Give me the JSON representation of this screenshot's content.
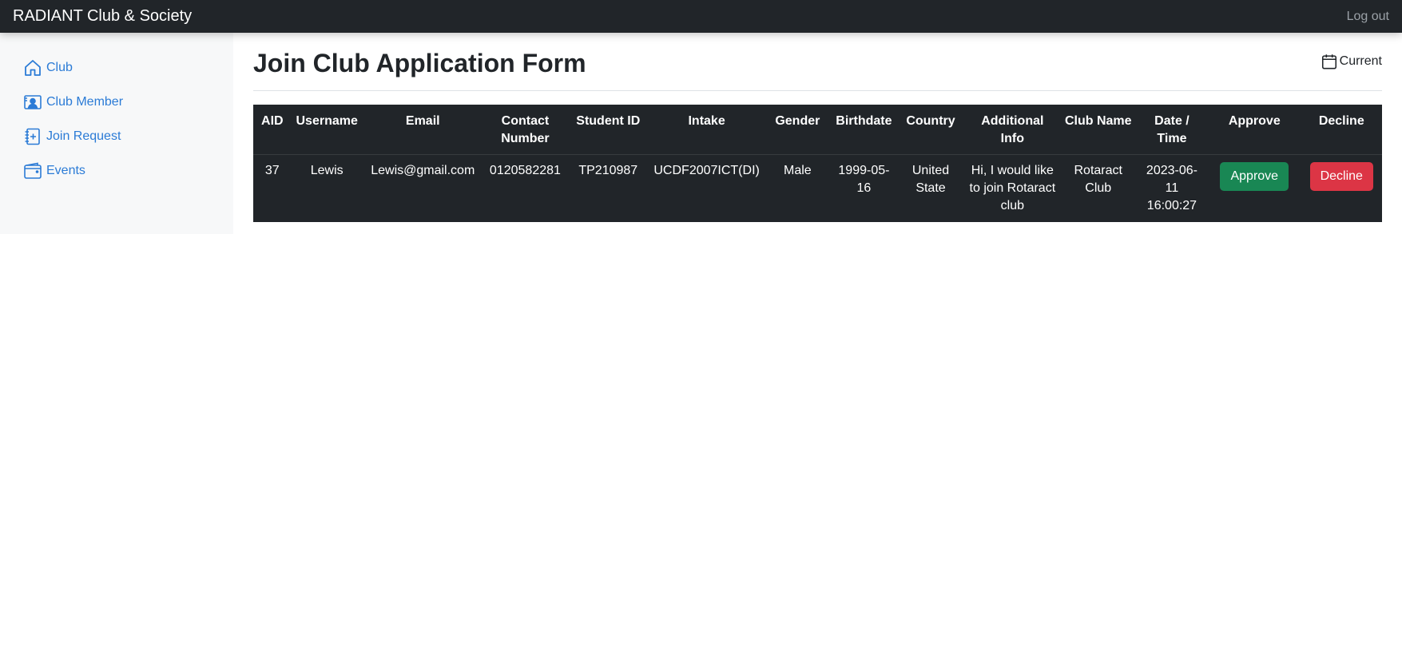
{
  "topbar": {
    "brand": "RADIANT Club & Society",
    "logout": "Log out"
  },
  "sidebar": {
    "items": [
      {
        "label": "Club",
        "icon": "home-icon"
      },
      {
        "label": "Club Member",
        "icon": "member-card-icon"
      },
      {
        "label": "Join Request",
        "icon": "join-request-icon"
      },
      {
        "label": "Events",
        "icon": "wallet-icon"
      }
    ]
  },
  "main": {
    "title": "Join Club Application Form",
    "current_label": "Current",
    "table": {
      "headers": [
        "AID",
        "Username",
        "Email",
        "Contact Number",
        "Student ID",
        "Intake",
        "Gender",
        "Birthdate",
        "Country",
        "Additional Info",
        "Club Name",
        "Date / Time",
        "Approve",
        "Decline"
      ],
      "rows": [
        {
          "aid": "37",
          "username": "Lewis",
          "email": "Lewis@gmail.com",
          "contact": "0120582281",
          "student_id": "TP210987",
          "intake": "UCDF2007ICT(DI)",
          "gender": "Male",
          "birthdate": "1999-05-16",
          "country": "United State",
          "info": "Hi, I would like to join Rotaract club",
          "club": "Rotaract Club",
          "datetime": "2023-06-11 16:00:27",
          "approve": "Approve",
          "decline": "Decline"
        }
      ]
    }
  },
  "colors": {
    "topbar": "#212529",
    "link": "#2b7bd6",
    "approve": "#198754",
    "decline": "#dc3545"
  }
}
